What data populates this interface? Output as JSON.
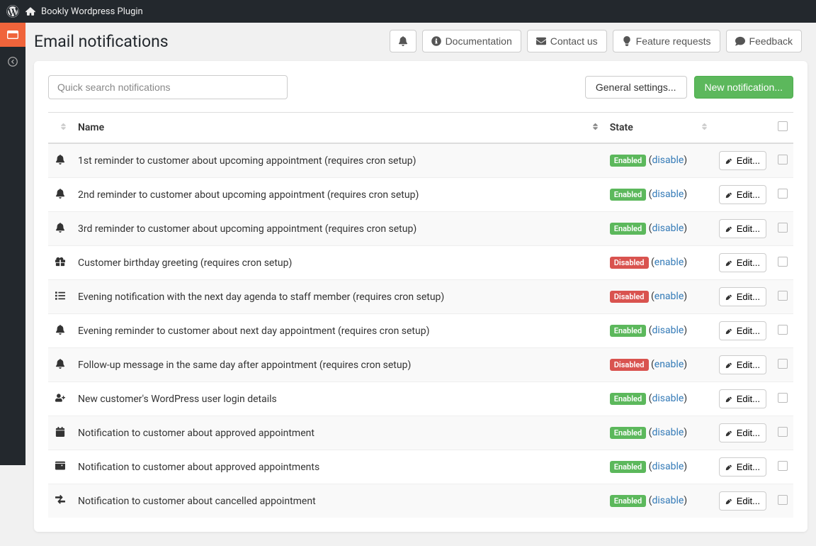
{
  "topbar": {
    "site_name": "Bookly Wordpress Plugin"
  },
  "page": {
    "title": "Email notifications"
  },
  "header_buttons": {
    "documentation": "Documentation",
    "contact": "Contact us",
    "feature": "Feature requests",
    "feedback": "Feedback"
  },
  "search": {
    "placeholder": "Quick search notifications"
  },
  "panel_buttons": {
    "general_settings": "General settings...",
    "new_notification": "New notification..."
  },
  "table": {
    "headers": {
      "name": "Name",
      "state": "State"
    },
    "edit_label": "Edit...",
    "states": {
      "enabled": "Enabled",
      "disabled": "Disabled"
    },
    "actions": {
      "disable": "disable",
      "enable": "enable"
    }
  },
  "rows": [
    {
      "icon": "bell",
      "name": "1st reminder to customer about upcoming appointment (requires cron setup)",
      "enabled": true
    },
    {
      "icon": "bell",
      "name": "2nd reminder to customer about upcoming appointment (requires cron setup)",
      "enabled": true
    },
    {
      "icon": "bell",
      "name": "3rd reminder to customer about upcoming appointment (requires cron setup)",
      "enabled": true
    },
    {
      "icon": "gift",
      "name": "Customer birthday greeting (requires cron setup)",
      "enabled": false
    },
    {
      "icon": "list",
      "name": "Evening notification with the next day agenda to staff member (requires cron setup)",
      "enabled": false
    },
    {
      "icon": "bell",
      "name": "Evening reminder to customer about next day appointment (requires cron setup)",
      "enabled": true
    },
    {
      "icon": "bell",
      "name": "Follow-up message in the same day after appointment (requires cron setup)",
      "enabled": false
    },
    {
      "icon": "user-plus",
      "name": "New customer's WordPress user login details",
      "enabled": true
    },
    {
      "icon": "calendar",
      "name": "Notification to customer about approved appointment",
      "enabled": true
    },
    {
      "icon": "cart",
      "name": "Notification to customer about approved appointments",
      "enabled": true
    },
    {
      "icon": "arrows",
      "name": "Notification to customer about cancelled appointment",
      "enabled": true
    }
  ]
}
